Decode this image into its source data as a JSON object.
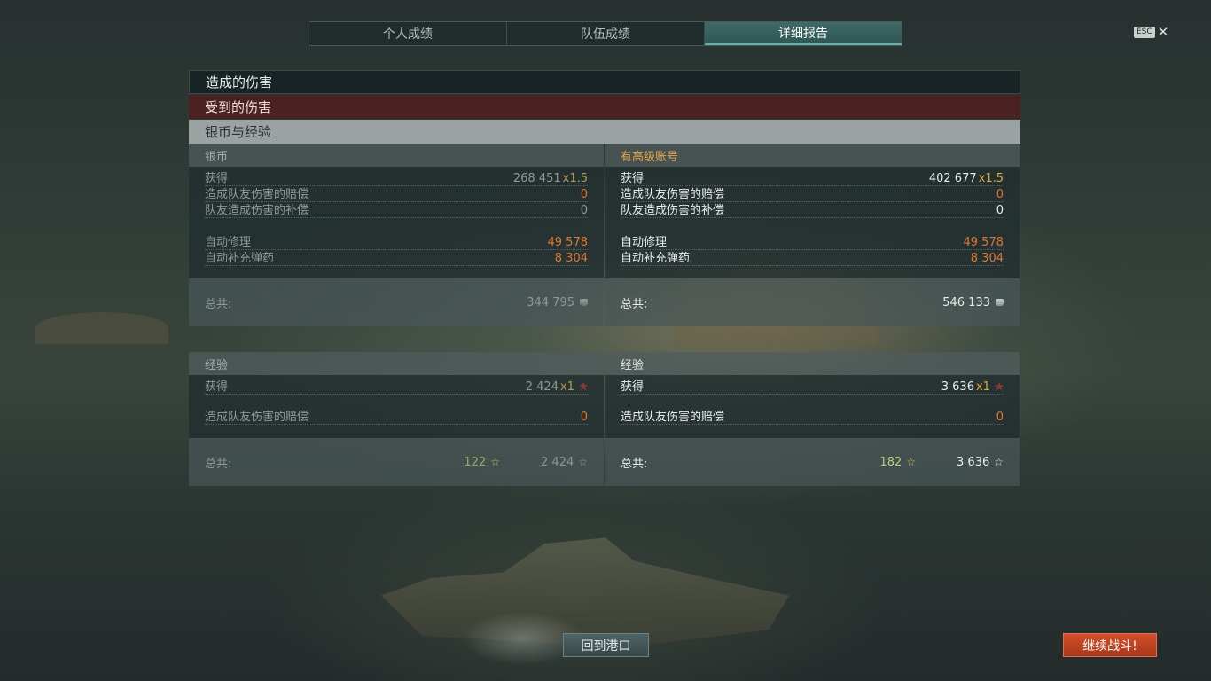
{
  "tabs": [
    {
      "label": "个人成绩",
      "active": false
    },
    {
      "label": "队伍成绩",
      "active": false
    },
    {
      "label": "详细报告",
      "active": true
    }
  ],
  "esc": {
    "badge": "ESC",
    "close": "✕"
  },
  "sections": {
    "damage_dealt": "造成的伤害",
    "damage_received": "受到的伤害",
    "credits_xp": "银币与经验"
  },
  "credits": {
    "standard": {
      "title": "银币",
      "earned_label": "获得",
      "earned_value": "268 451",
      "earned_mult": "x1.5",
      "team_damage_penalty_label": "造成队友伤害的赔偿",
      "team_damage_penalty_value": "0",
      "team_damage_compensation_label": "队友造成伤害的补偿",
      "team_damage_compensation_value": "0",
      "repair_label": "自动修理",
      "repair_value": "49 578",
      "resupply_label": "自动补充弹药",
      "resupply_value": "8 304",
      "total_label": "总共:",
      "total_value": "344 795"
    },
    "premium": {
      "title": "有高级账号",
      "earned_label": "获得",
      "earned_value": "402 677",
      "earned_mult": "x1.5",
      "team_damage_penalty_label": "造成队友伤害的赔偿",
      "team_damage_penalty_value": "0",
      "team_damage_compensation_label": "队友造成伤害的补偿",
      "team_damage_compensation_value": "0",
      "repair_label": "自动修理",
      "repair_value": "49 578",
      "resupply_label": "自动补充弹药",
      "resupply_value": "8 304",
      "total_label": "总共:",
      "total_value": "546 133"
    }
  },
  "experience": {
    "standard": {
      "title": "经验",
      "earned_label": "获得",
      "earned_value": "2 424",
      "earned_mult": "x1",
      "team_damage_penalty_label": "造成队友伤害的赔偿",
      "team_damage_penalty_value": "0",
      "total_label": "总共:",
      "free_xp": "122",
      "total_value": "2 424"
    },
    "premium": {
      "title": "经验",
      "earned_label": "获得",
      "earned_value": "3 636",
      "earned_mult": "x1",
      "team_damage_penalty_label": "造成队友伤害的赔偿",
      "team_damage_penalty_value": "0",
      "total_label": "总共:",
      "free_xp": "182",
      "total_value": "3 636"
    }
  },
  "buttons": {
    "return_to_port": "回到港口",
    "continue_battle": "继续战斗!"
  },
  "colors": {
    "accent_teal": "#5fb3aa",
    "penalty_orange": "#e0752e",
    "premium_gold": "#e7a84a",
    "continue_red": "#c0431f"
  }
}
